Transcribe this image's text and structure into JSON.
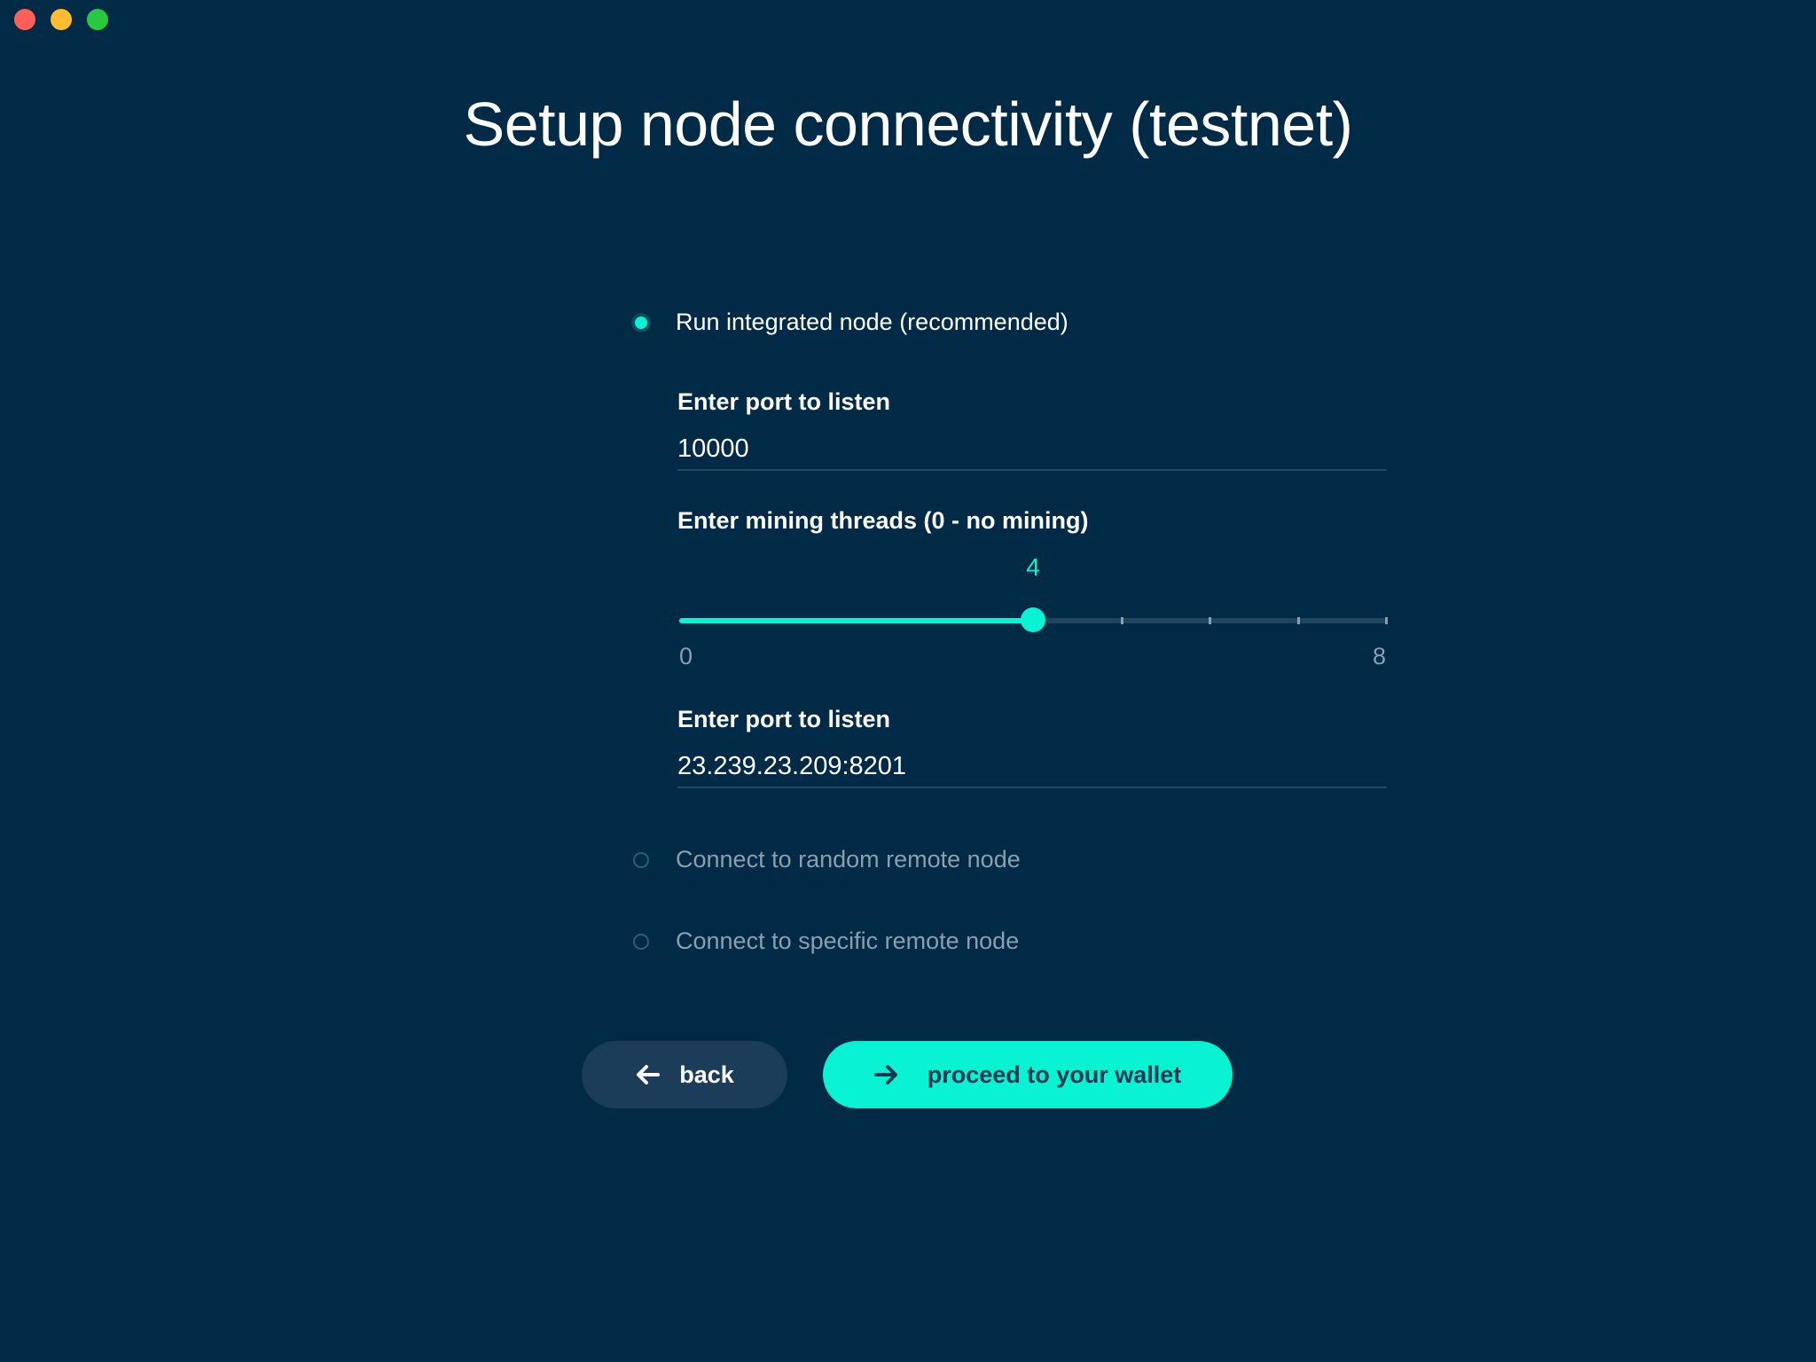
{
  "window": {
    "controls": [
      "close",
      "minimize",
      "zoom"
    ]
  },
  "title": "Setup node connectivity (testnet)",
  "options": [
    {
      "label": "Run integrated node (recommended)",
      "selected": true
    },
    {
      "label": "Connect to random remote node",
      "selected": false
    },
    {
      "label": "Connect to specific remote node",
      "selected": false
    }
  ],
  "integrated": {
    "port_label": "Enter port to listen",
    "port_value": "10000",
    "mining_label": "Enter mining threads (0 - no mining)",
    "mining_value": "4",
    "mining_min": "0",
    "mining_max": "8",
    "mining_fraction": 0.5,
    "peer_label": "Enter port to listen",
    "peer_value": "23.239.23.209:8201"
  },
  "buttons": {
    "back_label": "back",
    "proceed_label": "proceed to your wallet",
    "back_icon": "arrow-left-icon",
    "proceed_icon": "arrow-right-icon"
  },
  "colors": {
    "background": "#002a45",
    "accent": "#08f2d3",
    "secondary_button": "#1c3d59"
  }
}
